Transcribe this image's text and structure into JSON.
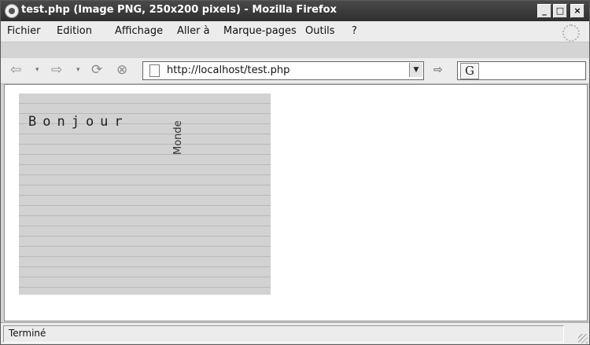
{
  "window": {
    "title": "test.php (Image PNG, 250x200 pixels) - Mozilla Firefox",
    "minimize_label": "_",
    "maximize_label": "□",
    "close_label": "×"
  },
  "menu": {
    "items": [
      {
        "label": "Fichier"
      },
      {
        "label": "Edition"
      },
      {
        "label": "Affichage"
      },
      {
        "label": "Aller à"
      },
      {
        "label": "Marque-pages"
      },
      {
        "label": "Outils"
      },
      {
        "label": "?"
      }
    ]
  },
  "toolbar": {
    "back_icon": "⇦",
    "forward_icon": "⇨",
    "dropdown_glyph": "▾",
    "reload_icon": "⟳",
    "stop_icon": "⊗",
    "url": "http://localhost/test.php",
    "url_dropdown_glyph": "▼",
    "go_icon": "⇨",
    "search_engine_glyph": "G"
  },
  "content": {
    "image_text_horizontal": "Bonjour",
    "image_text_vertical": "Monde",
    "image_background": "#d2d2d2",
    "line_color": "#b9b9b9"
  },
  "status": {
    "text": "Terminé"
  }
}
